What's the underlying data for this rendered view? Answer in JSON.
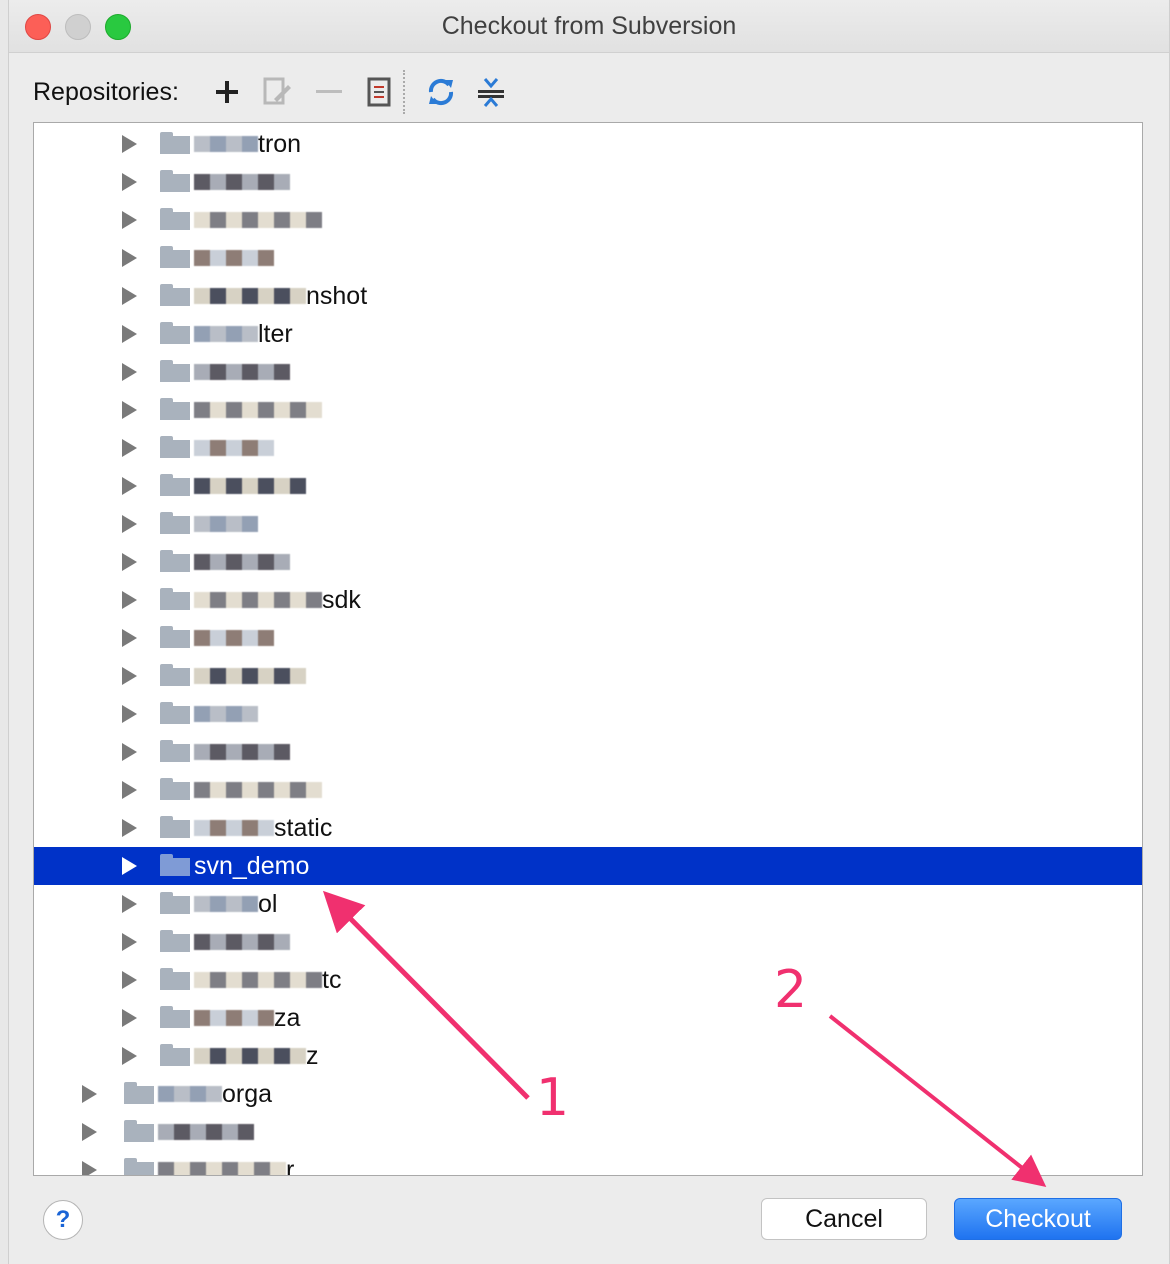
{
  "window": {
    "title": "Checkout from Subversion"
  },
  "toolbar": {
    "label": "Repositories:",
    "icons": [
      "add-icon",
      "edit-icon",
      "remove-icon",
      "browse-icon",
      "refresh-icon",
      "collapse-icon"
    ]
  },
  "tree": {
    "rows": [
      {
        "label": "tron"
      },
      {
        "label": ""
      },
      {
        "label": ""
      },
      {
        "label": ""
      },
      {
        "label": "nshot"
      },
      {
        "label": "lter"
      },
      {
        "label": ""
      },
      {
        "label": ""
      },
      {
        "label": ""
      },
      {
        "label": ""
      },
      {
        "label": ""
      },
      {
        "label": ""
      },
      {
        "label": "sdk"
      },
      {
        "label": ""
      },
      {
        "label": ""
      },
      {
        "label": ""
      },
      {
        "label": ""
      },
      {
        "label": ""
      },
      {
        "label": "static"
      },
      {
        "label": "svn_demo"
      },
      {
        "label": "ol"
      },
      {
        "label": ""
      },
      {
        "label": "tc"
      },
      {
        "label": "za"
      },
      {
        "label": "z"
      },
      {
        "label": "orga"
      },
      {
        "label": ""
      },
      {
        "label": "r"
      }
    ],
    "selected_label": "svn_demo"
  },
  "buttons": {
    "help": "?",
    "cancel": "Cancel",
    "checkout": "Checkout"
  },
  "annotations": {
    "one": "1",
    "two": "2"
  },
  "colors": {
    "selection": "#0032c8",
    "annotation": "#f0306f",
    "primary_button": "#1f73f0"
  }
}
